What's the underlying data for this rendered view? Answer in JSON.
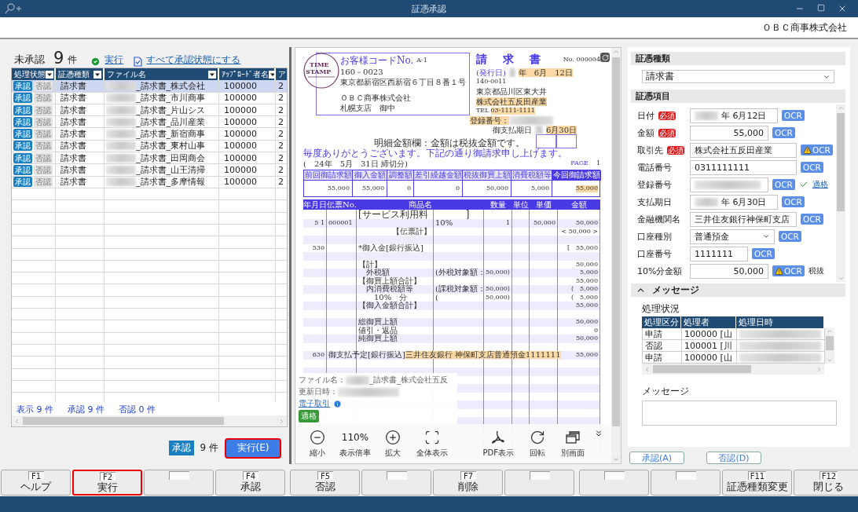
{
  "window": {
    "title": "証憑承認"
  },
  "company": "ＯＢＣ商事株式会社",
  "left": {
    "pending_label": "未承認",
    "pending_count": "9",
    "pending_unit": "件",
    "run_link": "実行",
    "approve_all_link": "すべて承認状態にする",
    "columns": [
      "処理状態",
      "証憑種類",
      "ファイル名",
      "ｱｯﾌﾟﾛｰﾄﾞ者名",
      "ア"
    ],
    "rows": [
      {
        "status": [
          {
            "label": "承認",
            "selected": true
          },
          {
            "label": "否認",
            "selected": false
          }
        ],
        "type": "請求書",
        "file": "_請求書_株式会社",
        "uploader": "100000",
        "column_5": "2",
        "selected": true
      },
      {
        "status": [
          {
            "label": "承認",
            "selected": true
          },
          {
            "label": "否認",
            "selected": false
          }
        ],
        "type": "請求書",
        "file": "_請求書_市川商事",
        "uploader": "100000",
        "column_5": "2",
        "selected": false
      },
      {
        "status": [
          {
            "label": "承認",
            "selected": true
          },
          {
            "label": "否認",
            "selected": false
          }
        ],
        "type": "請求書",
        "file": "_請求書_片山シス",
        "uploader": "100000",
        "column_5": "2",
        "selected": false
      },
      {
        "status": [
          {
            "label": "承認",
            "selected": true
          },
          {
            "label": "否認",
            "selected": false
          }
        ],
        "type": "請求書",
        "file": "_請求書_品川産業",
        "uploader": "100000",
        "column_5": "2",
        "selected": false
      },
      {
        "status": [
          {
            "label": "承認",
            "selected": true
          },
          {
            "label": "否認",
            "selected": false
          }
        ],
        "type": "請求書",
        "file": "_請求書_新宿商事",
        "uploader": "100000",
        "column_5": "2",
        "selected": false
      },
      {
        "status": [
          {
            "label": "承認",
            "selected": true
          },
          {
            "label": "否認",
            "selected": false
          }
        ],
        "type": "請求書",
        "file": "_請求書_東村山事",
        "uploader": "100000",
        "column_5": "2",
        "selected": false
      },
      {
        "status": [
          {
            "label": "承認",
            "selected": true
          },
          {
            "label": "否認",
            "selected": false
          }
        ],
        "type": "請求書",
        "file": "_請求書_田岡商会",
        "uploader": "100000",
        "column_5": "2",
        "selected": false
      },
      {
        "status": [
          {
            "label": "承認",
            "selected": true
          },
          {
            "label": "否認",
            "selected": false
          }
        ],
        "type": "請求書",
        "file": "_請求書_山王清掃",
        "uploader": "100000",
        "column_5": "2",
        "selected": false
      },
      {
        "status": [
          {
            "label": "承認",
            "selected": true
          },
          {
            "label": "否認",
            "selected": false
          }
        ],
        "type": "請求書",
        "file": "_請求書_多摩情報",
        "uploader": "100000",
        "column_5": "2",
        "selected": false
      }
    ],
    "footer": [
      "表示 9 件",
      "承認 9 件",
      "否認 0 件"
    ],
    "action": {
      "badge": "承認",
      "count": "9 件",
      "button": "実行(E)",
      "highlighted": true
    }
  },
  "document": {
    "stamp": [
      "TIME",
      "STAMP"
    ],
    "customer_code_label": "お客様コードNo.",
    "customer_code": "A-1",
    "postal": "160－0023",
    "address": "東京都新宿区西新宿６丁目８番１号",
    "recipient": "ＯＢＣ商事株式会社",
    "recipient_branch": "札幌支店　御中",
    "title": "請　求　書",
    "number": "No. 000004",
    "issue_label": "(発行日)",
    "issue_date": {
      "text": "年　6月　12日",
      "highlighted": true
    },
    "sender_postal": "140-0011",
    "sender_address": "東京都品川区東大井",
    "sender_name": {
      "text": "株式会社五反田産業",
      "highlighted": true
    },
    "sender_tel_label": "TEL",
    "sender_tel": {
      "text": "03-1111-1111",
      "highlighted": true
    },
    "registration": {
      "text": "登録番号：",
      "highlighted": true
    },
    "due_label": "御支払期日",
    "due_date": {
      "text": "6月30日",
      "highlighted": true
    },
    "note": "明細金額欄：金額は税抜金額です。",
    "greeting": "毎度ありがとうございます。下記の通り御請求申し上げます。",
    "period": "(　24年　5月　31日 締切分)",
    "page_label": "PAGE",
    "page": "1",
    "summary_columns": [
      "前回御請求額",
      "御入金額",
      "調整額",
      "差引繰越金額",
      "税抜御買上額",
      "消費税額等",
      "今回御請求額"
    ],
    "summary_values": [
      {
        "text": "55,000",
        "highlighted": false
      },
      {
        "text": "55,000",
        "highlighted": false
      },
      {
        "text": "0",
        "highlighted": false
      },
      {
        "text": "0",
        "highlighted": false
      },
      {
        "text": "50,000",
        "highlighted": false
      },
      {
        "text": "5,000",
        "highlighted": false
      },
      {
        "text": "55,000",
        "highlighted": true
      }
    ],
    "detail_columns": [
      "年月日",
      "伝票No.",
      "商品名",
      "数量",
      "単位",
      "単価",
      "金額"
    ],
    "detail_rows": [
      {
        "name": "[サービス利用料　　　　]"
      },
      {
        "date": "5 1",
        "no": "000001",
        "note": "10%",
        "qty": "1",
        "price": "50,000",
        "amount": "50,000"
      },
      {
        "kind": "subtotal",
        "name": "【伝票計】",
        "amount": "< 50,000 >"
      },
      {},
      {
        "date": "530",
        "name": "*御入金[銀行振込]",
        "amount": "[　55,000"
      },
      {},
      {
        "name": "【計】",
        "amount": "50,000"
      },
      {
        "name": "　外税額",
        "note": "(外税対象額：",
        "qty": "50,000)",
        "amount": "5,000"
      },
      {
        "name": "【御買上額合計】",
        "amount": "55,000"
      },
      {
        "name": "　内消費税額等",
        "note": "(課税対象額：",
        "qty": "50,000)",
        "amount": "(　5,000"
      },
      {
        "name": "　　10%　分",
        "note": "(",
        "qty": "50,000)",
        "amount": "(　5,000"
      },
      {
        "name": "【御入金額合計】",
        "amount": "55,000"
      },
      {},
      {
        "name": "総御買上額",
        "amount": "50,000"
      },
      {
        "name": "値引・返品",
        "amount": "0"
      },
      {
        "name": "純御買上額",
        "amount": "50,000"
      },
      {},
      {
        "date": "630",
        "segments": [
          {
            "text": "御支払予定[銀行振込]",
            "highlighted": false
          },
          {
            "text": "三井住友銀行 神保町支店",
            "highlighted": true
          },
          {
            "text": "普通預金",
            "highlighted": true
          },
          {
            "text": "1111111",
            "highlighted": true
          }
        ],
        "amount": "55,000"
      }
    ]
  },
  "file_info": {
    "file_label": "ファイル名：",
    "file_name": "_請求書_株式会社五反",
    "updated_label": "更新日時：",
    "link": "電子取引",
    "badge": "適格"
  },
  "toolbar": [
    {
      "kind": "zoom_out",
      "label": "縮小"
    },
    {
      "kind": "zoom_level",
      "value": "110%",
      "label": "表示倍率"
    },
    {
      "kind": "zoom_in",
      "label": "拡大"
    },
    {
      "kind": "fit",
      "label": "全体表示"
    },
    {
      "kind": "pdf",
      "label": "PDF表示"
    },
    {
      "kind": "rotate",
      "label": "回転"
    },
    {
      "kind": "window",
      "label": "別画面"
    }
  ],
  "right": {
    "type_header": "証憑種類",
    "type_value": "請求書",
    "items_header": "証憑項目",
    "fields": [
      {
        "label": "日付",
        "required": true,
        "required_label": "必須",
        "kind": "date",
        "blurred": true,
        "value": "年  6月12日",
        "ocr": {
          "label": "OCR",
          "warning": false
        }
      },
      {
        "label": "金額",
        "required": true,
        "required_label": "必須",
        "kind": "amount",
        "blurred": false,
        "value": "55,000",
        "ocr": {
          "label": "OCR",
          "warning": false
        }
      },
      {
        "label": "取引先",
        "required": true,
        "required_label": "必須",
        "kind": "text",
        "blurred": false,
        "value": "株式会社五反田産業",
        "ocr": {
          "label": "OCR",
          "warning": true
        }
      },
      {
        "label": "電話番号",
        "required": false,
        "kind": "text",
        "blurred": false,
        "value": "0311111111",
        "ocr": {
          "label": "OCR",
          "warning": false
        }
      },
      {
        "label": "登録番号",
        "required": false,
        "kind": "id",
        "blurred": true,
        "ocr": {
          "label": "OCR",
          "warning": false
        },
        "verified": "適格"
      },
      {
        "label": "支払期日",
        "required": false,
        "kind": "date",
        "blurred": true,
        "value": "年  6月30日",
        "ocr": {
          "label": "OCR",
          "warning": false
        }
      },
      {
        "label": "金融機関名",
        "required": false,
        "kind": "text",
        "blurred": false,
        "value": "三井住友銀行神保町支店",
        "ocr": {
          "label": "OCR",
          "warning": false
        }
      },
      {
        "label": "口座種別",
        "required": false,
        "kind": "select",
        "blurred": false,
        "value": "普通預金",
        "ocr": {
          "label": "OCR",
          "warning": false
        }
      },
      {
        "label": "口座番号",
        "required": false,
        "kind": "number",
        "blurred": false,
        "value": "1111111",
        "ocr": {
          "label": "OCR",
          "warning": false
        }
      },
      {
        "label": "10%分金額",
        "required": false,
        "kind": "amount",
        "blurred": false,
        "value": "50,000",
        "ocr": {
          "label": "OCR",
          "warning": true
        },
        "suffix": "税抜"
      }
    ],
    "message_section": {
      "title": "メッセージ",
      "expanded": true
    },
    "history_label": "処理状況",
    "history_columns": [
      "処理区分",
      "処理者",
      "処理日時"
    ],
    "history_rows": [
      {
        "type": "申請",
        "user": "100000 [山"
      },
      {
        "type": "否認",
        "user": "100001 [川"
      },
      {
        "type": "申請",
        "user": "100000 [山"
      }
    ],
    "message_label": "メッセージ",
    "buttons": [
      "承認(A)",
      "否認(D)"
    ]
  },
  "function_keys": [
    {
      "key": "F1",
      "label": "ヘルプ",
      "highlighted": false
    },
    {
      "key": "F2",
      "label": "実行",
      "highlighted": true
    },
    {
      "highlighted": false
    },
    {
      "key": "F4",
      "label": "承認",
      "highlighted": false
    },
    {
      "key": "F5",
      "label": "否認",
      "highlighted": false
    },
    {
      "highlighted": false
    },
    {
      "key": "F7",
      "label": "削除",
      "highlighted": false
    },
    {
      "highlighted": false
    },
    {
      "highlighted": false
    },
    {
      "highlighted": false
    },
    {
      "key": "F11",
      "label": "証憑種類変更",
      "highlighted": false
    },
    {
      "key": "F12",
      "label": "閉じる",
      "highlighted": false
    }
  ]
}
